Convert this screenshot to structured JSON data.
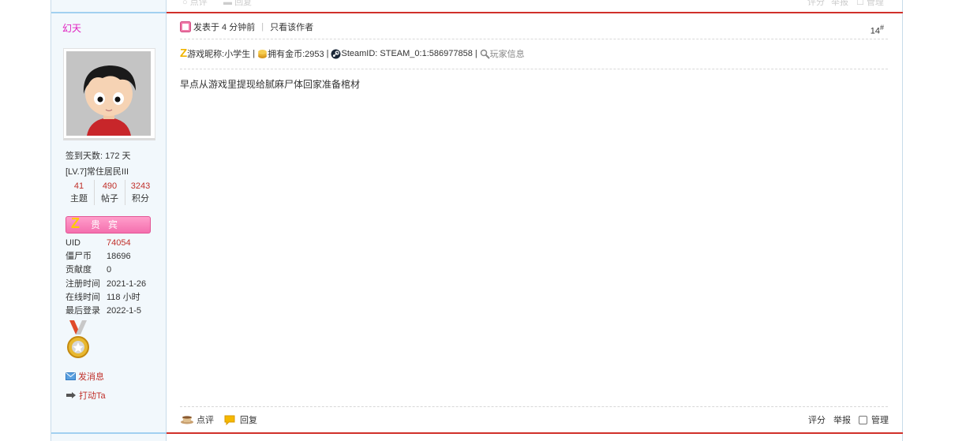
{
  "prev_post": {
    "comment_label": "点评",
    "reply_label": "回复",
    "rate_label": "评分",
    "report_label": "举报",
    "manage_label": "管理"
  },
  "author": {
    "name": "幻天",
    "checkin": "签到天数: 172 天",
    "level": "[LV.7]常住居民III",
    "stats": [
      {
        "num": "41",
        "label": "主题"
      },
      {
        "num": "490",
        "label": "帖子"
      },
      {
        "num": "3243",
        "label": "积分"
      }
    ],
    "vip_label": "贵宾",
    "vip_mark": "Z",
    "info": [
      {
        "key": "UID",
        "value": "74054"
      },
      {
        "key": "僵尸币",
        "value": "18696"
      },
      {
        "key": "贡献度",
        "value": "0"
      },
      {
        "key": "注册时间",
        "value": "2021-1-26"
      },
      {
        "key": "在线时间",
        "value": "118 小时"
      },
      {
        "key": "最后登录",
        "value": "2022-1-5"
      }
    ],
    "send_message": "发消息",
    "poke": "打动Ta"
  },
  "post": {
    "posted": "发表于 4 分钟前",
    "author_only": "只看该作者",
    "floor": "14",
    "floor_mark": "#",
    "game_nick": "游戏昵称:小学生",
    "coins": "拥有金币:2953",
    "steam": "SteamID: STEAM_0:1:586977858",
    "player_info": "玩家信息",
    "content": "早点从游戏里提现给腻麻尸体回家准备棺材"
  },
  "footer": {
    "comment_label": "点评",
    "reply_label": "回复",
    "rate_label": "评分",
    "report_label": "举报",
    "manage_label": "管理"
  },
  "colors": {
    "accent_red": "#d0302a",
    "sidebar_bg": "#f2f8fc",
    "author_color": "#e020c0"
  }
}
